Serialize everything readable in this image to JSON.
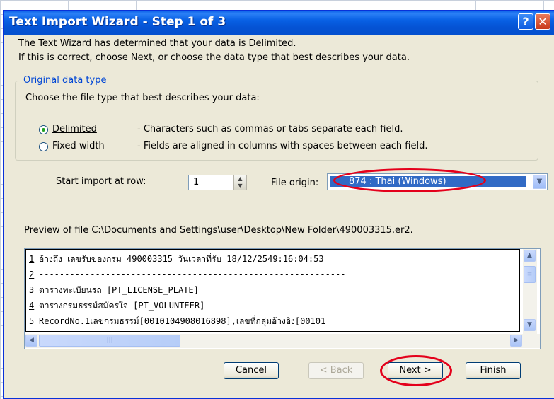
{
  "dialog": {
    "title": "Text Import Wizard - Step 1 of 3",
    "help_icon": "?",
    "close_icon": "✕"
  },
  "intro": {
    "line1": "The Text Wizard has determined that your data is Delimited.",
    "line2": "If this is correct, choose Next, or choose the data type that best describes your data."
  },
  "original_data_type": {
    "legend": "Original data type",
    "prompt": "Choose the file type that best describes your data:",
    "options": [
      {
        "label": "Delimited",
        "description": "- Characters such as commas or tabs separate each field.",
        "selected": true
      },
      {
        "label": "Fixed width",
        "description": "- Fields are aligned in columns with spaces between each field.",
        "selected": false
      }
    ]
  },
  "start_import": {
    "label": "Start import at row:",
    "value": "1"
  },
  "file_origin": {
    "label": "File origin:",
    "value": "874 : Thai (Windows)"
  },
  "preview": {
    "label": "Preview of file C:\\Documents and Settings\\user\\Desktop\\New Folder\\490003315.er2.",
    "lines": [
      {
        "num": "1",
        "text": "อ้างถึง เลขรับของกรม 490003315 วันเวลาที่รับ 18/12/2549:16:04:53"
      },
      {
        "num": "2",
        "text": "------------------------------------------------------------"
      },
      {
        "num": "3",
        "text": "ตารางทะเบียนรถ [PT_LICENSE_PLATE]"
      },
      {
        "num": "4",
        "text": "ตารางกรมธรรม์สมัครใจ [PT_VOLUNTEER]"
      },
      {
        "num": "5",
        "text": "RecordNo.1เลขกรมธรรม์[0010104908016898],เลขที่กลุ่มอ้างอิง[00101"
      }
    ]
  },
  "buttons": {
    "cancel": "Cancel",
    "back": "< Back",
    "next": "Next >",
    "finish": "Finish"
  },
  "colors": {
    "titlebar": "#0553d4",
    "dialog_bg": "#ece9d8",
    "highlight": "#316ac5",
    "annotation": "#e4001b"
  }
}
